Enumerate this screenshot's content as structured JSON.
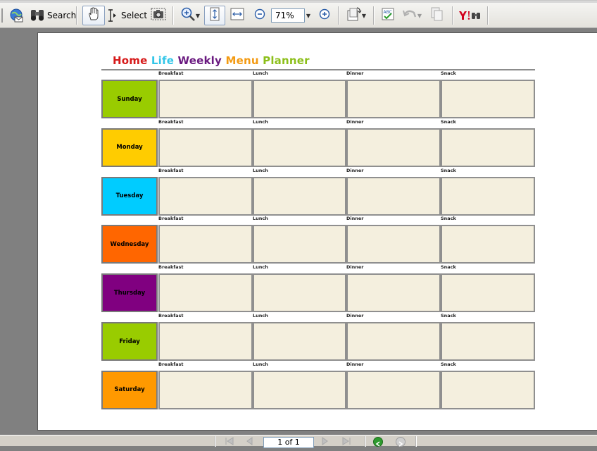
{
  "toolbar": {
    "search_label": "Search",
    "select_label": "Select",
    "zoom_value": "71%"
  },
  "document": {
    "title_words": [
      {
        "text": "Home",
        "color": "#d61a1a"
      },
      {
        "text": "Life",
        "color": "#33c6e8"
      },
      {
        "text": "Weekly",
        "color": "#6a1a80"
      },
      {
        "text": "Menu",
        "color": "#f39a12"
      },
      {
        "text": "Planner",
        "color": "#8cbf1a"
      }
    ],
    "meal_columns": [
      "Breakfast",
      "Lunch",
      "Dinner",
      "Snack"
    ],
    "days": [
      {
        "name": "Sunday",
        "color": "#99cc00"
      },
      {
        "name": "Monday",
        "color": "#ffcc00"
      },
      {
        "name": "Tuesday",
        "color": "#00ccff"
      },
      {
        "name": "Wednesday",
        "color": "#ff6600"
      },
      {
        "name": "Thursday",
        "color": "#800080"
      },
      {
        "name": "Friday",
        "color": "#99cc00"
      },
      {
        "name": "Saturday",
        "color": "#ff9900"
      }
    ]
  },
  "statusbar": {
    "page_indicator": "1 of 1"
  }
}
